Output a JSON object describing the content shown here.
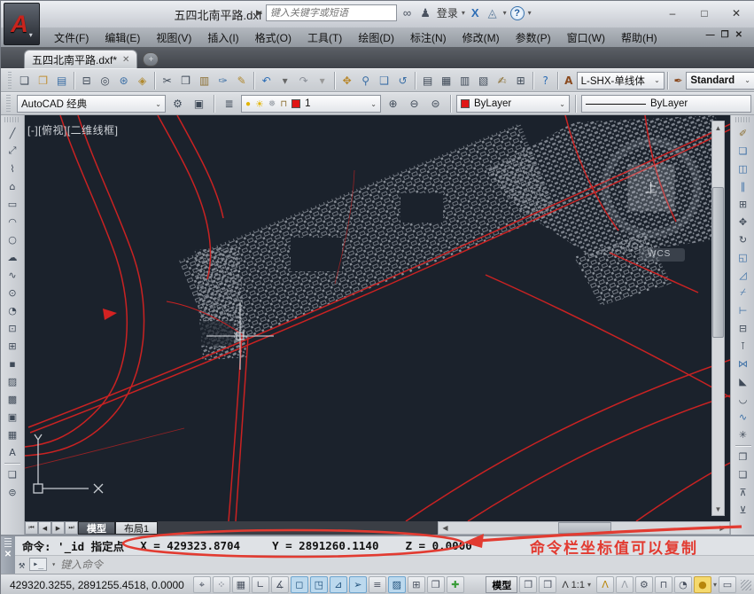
{
  "colors": {
    "accent_red": "#d42222",
    "annotation_red": "#e23b31",
    "canvas_bg": "#1b222c",
    "active_toggle": "#bcd9ee",
    "layer_color": "#e01616"
  },
  "titlebar": {
    "title": "五四北南平路.dxf",
    "search_placeholder": "键入关键字或短语",
    "signin_label": "登录",
    "minimize": "–",
    "maximize": "□",
    "close": "✕"
  },
  "menubar": {
    "items": [
      {
        "name": "menu-file",
        "label": "文件(F)"
      },
      {
        "name": "menu-edit",
        "label": "编辑(E)"
      },
      {
        "name": "menu-view",
        "label": "视图(V)"
      },
      {
        "name": "menu-insert",
        "label": "插入(I)"
      },
      {
        "name": "menu-format",
        "label": "格式(O)"
      },
      {
        "name": "menu-tools",
        "label": "工具(T)"
      },
      {
        "name": "menu-draw",
        "label": "绘图(D)"
      },
      {
        "name": "menu-dimension",
        "label": "标注(N)"
      },
      {
        "name": "menu-modify",
        "label": "修改(M)"
      },
      {
        "name": "menu-parametric",
        "label": "参数(P)"
      },
      {
        "name": "menu-window",
        "label": "窗口(W)"
      },
      {
        "name": "menu-help",
        "label": "帮助(H)"
      }
    ]
  },
  "filetabs": {
    "active_tab": "五四北南平路.dxf*",
    "close_glyph": "✕",
    "new_tab_glyph": "+"
  },
  "standard_toolbar": {
    "items": [
      {
        "name": "new-file-icon",
        "glyph": "❏"
      },
      {
        "name": "open-file-icon",
        "glyph": "❐",
        "c": "#c09035"
      },
      {
        "name": "save-icon",
        "glyph": "▤",
        "c": "#3a6ea5"
      },
      {
        "sep": true
      },
      {
        "name": "print-icon",
        "glyph": "⊟"
      },
      {
        "name": "print-preview-icon",
        "glyph": "◎"
      },
      {
        "name": "publish-icon",
        "glyph": "⊛",
        "c": "#3a6ea5"
      },
      {
        "name": "export-dwf-icon",
        "glyph": "◈",
        "c": "#b0892f"
      },
      {
        "sep": true
      },
      {
        "name": "cut-icon",
        "glyph": "✂"
      },
      {
        "name": "copy-clip-icon",
        "glyph": "❒"
      },
      {
        "name": "paste-icon",
        "glyph": "▥",
        "c": "#8a6d2f"
      },
      {
        "name": "match-properties-icon",
        "glyph": "✑",
        "c": "#3a6ea5"
      },
      {
        "name": "block-editor-icon",
        "glyph": "✎",
        "c": "#b0892f"
      },
      {
        "sep": true
      },
      {
        "name": "undo-icon",
        "glyph": "↶",
        "c": "#2d6db5"
      },
      {
        "name": "undo-caret",
        "glyph": "▾",
        "c": "#666"
      },
      {
        "name": "redo-icon",
        "glyph": "↷",
        "c": "#8a8f98"
      },
      {
        "name": "redo-caret",
        "glyph": "▾",
        "c": "#999"
      },
      {
        "sep": true
      },
      {
        "name": "pan-icon",
        "glyph": "✥",
        "c": "#b8862a"
      },
      {
        "name": "zoom-realtime-icon",
        "glyph": "⚲",
        "c": "#3a6ea5"
      },
      {
        "name": "zoom-window-icon",
        "glyph": "❑",
        "c": "#3a6ea5"
      },
      {
        "name": "zoom-previous-icon",
        "glyph": "↺",
        "c": "#3a6ea5"
      },
      {
        "sep": true
      },
      {
        "name": "properties-palette-icon",
        "glyph": "▤"
      },
      {
        "name": "designcenter-icon",
        "glyph": "▦"
      },
      {
        "name": "tool-palettes-icon",
        "glyph": "▥"
      },
      {
        "name": "sheet-set-manager-icon",
        "glyph": "▧"
      },
      {
        "name": "markup-set-manager-icon",
        "glyph": "✍",
        "c": "#8a6d2f"
      },
      {
        "name": "quickcalc-icon",
        "glyph": "⊞"
      },
      {
        "sep": true
      },
      {
        "name": "help-icon",
        "glyph": "?",
        "c": "#2d6db5"
      }
    ]
  },
  "style_toolbar": {
    "text_style_icon": "A",
    "text_style_value": "L-SHX-单线体",
    "dim_style_icon": "✒",
    "dim_style_value": "Standard"
  },
  "workspace_toolbar": {
    "value": "AutoCAD 经典",
    "settings_glyph": "⚙",
    "save_ws_glyph": "▣"
  },
  "layer_toolbar": {
    "manager_glyph": "≣",
    "bulb_glyph": "●",
    "sun_glyph": "☀",
    "freeze_glyph": "❅",
    "lock_glyph": "⊓",
    "current_layer": "1",
    "tool1": "⊕",
    "tool2": "⊖",
    "tool3": "⊜"
  },
  "properties_toolbar": {
    "color_value": "ByLayer",
    "linetype_value": "ByLayer"
  },
  "draw_toolbar": {
    "items": [
      {
        "name": "line-icon",
        "glyph": "╱"
      },
      {
        "name": "construction-line-icon",
        "glyph": "⤢"
      },
      {
        "name": "polyline-icon",
        "glyph": "⌇"
      },
      {
        "name": "polygon-icon",
        "glyph": "⌂"
      },
      {
        "name": "rectangle-icon",
        "glyph": "▭"
      },
      {
        "name": "arc-icon",
        "glyph": "◠"
      },
      {
        "name": "circle-icon",
        "glyph": "○"
      },
      {
        "name": "revcloud-icon",
        "glyph": "☁"
      },
      {
        "name": "spline-icon",
        "glyph": "∿"
      },
      {
        "name": "ellipse-icon",
        "glyph": "⊙"
      },
      {
        "name": "ellipse-arc-icon",
        "glyph": "◔"
      },
      {
        "name": "insert-block-icon",
        "glyph": "⊡"
      },
      {
        "name": "create-block-icon",
        "glyph": "⊞"
      },
      {
        "name": "point-icon",
        "glyph": "▪"
      },
      {
        "name": "hatch-icon",
        "glyph": "▨"
      },
      {
        "name": "gradient-icon",
        "glyph": "▩"
      },
      {
        "name": "region-icon",
        "glyph": "▣"
      },
      {
        "name": "table-icon",
        "glyph": "▦"
      },
      {
        "name": "mtext-icon",
        "glyph": "A"
      },
      {
        "sep": true
      },
      {
        "name": "box-3d-icon",
        "glyph": "❑"
      },
      {
        "name": "sphere-3d-icon",
        "glyph": "⊜"
      }
    ]
  },
  "modify_toolbar": {
    "items": [
      {
        "name": "erase-icon",
        "glyph": "✐",
        "c": "#8a6d2f"
      },
      {
        "name": "copy-icon",
        "glyph": "❏",
        "c": "#3a6ea5"
      },
      {
        "name": "mirror-icon",
        "glyph": "◫",
        "c": "#3a6ea5"
      },
      {
        "name": "offset-icon",
        "glyph": "∥",
        "c": "#3a6ea5"
      },
      {
        "name": "array-icon",
        "glyph": "⊞"
      },
      {
        "name": "move-icon",
        "glyph": "✥"
      },
      {
        "name": "rotate-icon",
        "glyph": "↻"
      },
      {
        "name": "scale-icon",
        "glyph": "◱",
        "c": "#3a6ea5"
      },
      {
        "name": "stretch-icon",
        "glyph": "◿",
        "c": "#3a6ea5"
      },
      {
        "name": "trim-icon",
        "glyph": "⌿",
        "c": "#3a6ea5"
      },
      {
        "name": "extend-icon",
        "glyph": "⊢",
        "c": "#3a6ea5"
      },
      {
        "name": "break-icon",
        "glyph": "⊟"
      },
      {
        "name": "break-at-point-icon",
        "glyph": "⊺"
      },
      {
        "name": "join-icon",
        "glyph": "⋈",
        "c": "#3a6ea5"
      },
      {
        "name": "chamfer-icon",
        "glyph": "◣"
      },
      {
        "name": "fillet-icon",
        "glyph": "◡"
      },
      {
        "name": "blend-curves-icon",
        "glyph": "∿",
        "c": "#3a6ea5"
      },
      {
        "name": "explode-icon",
        "glyph": "✳"
      },
      {
        "sep": true
      },
      {
        "name": "bring-to-front-icon",
        "glyph": "❐"
      },
      {
        "name": "send-to-back-icon",
        "glyph": "❏"
      },
      {
        "name": "bring-above-icon",
        "glyph": "⊼"
      },
      {
        "name": "send-under-icon",
        "glyph": "⊻"
      }
    ]
  },
  "canvas": {
    "viewport_label": "[-][俯视][二维线框]",
    "viewcube_face": "上",
    "wcs_label": "WCS",
    "axis_x_label": "X",
    "axis_y_label": "Y"
  },
  "layout_tabs": {
    "nav_first": "⏮",
    "nav_prev": "◀",
    "nav_next": "▶",
    "nav_last": "⏭",
    "model": "模型",
    "layout1": "布局1"
  },
  "command": {
    "history_line": "命令: '_id 指定点",
    "coord_x": "X = 429323.8704",
    "coord_y": "Y = 2891260.1140",
    "coord_z": "Z = 0.0000",
    "prompt_chip": "▸_",
    "prompt_placeholder": "键入命令",
    "close_glyph": "✕",
    "wrench_glyph": "⚒",
    "annotation_text": "命令栏坐标值可以复制"
  },
  "statusbar": {
    "coordinates": "429320.3255, 2891255.4518, 0.0000",
    "toggles": [
      {
        "name": "infer-constraints-toggle",
        "glyph": "⌖"
      },
      {
        "name": "snap-mode-toggle",
        "glyph": "⁘"
      },
      {
        "name": "grid-display-toggle",
        "glyph": "▦"
      },
      {
        "name": "ortho-mode-toggle",
        "glyph": "∟"
      },
      {
        "name": "polar-tracking-toggle",
        "glyph": "∡"
      },
      {
        "name": "object-snap-toggle",
        "glyph": "◻",
        "active": true
      },
      {
        "name": "object-snap-3d-toggle",
        "glyph": "◳",
        "active": true
      },
      {
        "name": "dynamic-ucs-toggle",
        "glyph": "⊿",
        "active": true
      },
      {
        "name": "dynamic-input-toggle",
        "glyph": "➢",
        "active": true
      },
      {
        "name": "lineweight-toggle",
        "glyph": "≡"
      },
      {
        "name": "transparency-toggle",
        "glyph": "▨",
        "active": true
      },
      {
        "name": "quick-properties-toggle",
        "glyph": "⊞"
      },
      {
        "name": "selection-cycling-toggle",
        "glyph": "❒"
      },
      {
        "name": "annotation-monitor-toggle",
        "glyph": "✚",
        "c": "#3a9c3a"
      }
    ],
    "model_button": "模型",
    "quick_view_layouts_glyph": "❐",
    "quick_view_drawings_glyph": "❒",
    "annotation_scale_icon": "Λ",
    "annotation_scale": "1:1",
    "scale_caret": "▾",
    "annotation_visibility_glyph": "Λ",
    "auto-annotate_glyph": "Λ",
    "workspace_gear_glyph": "⚙",
    "lock_ui_glyph": "⊓",
    "hardware_accel_glyph": "◔",
    "bulb_glyph": "●",
    "bulb_caret": "▾",
    "clean_screen_glyph": "▭"
  }
}
